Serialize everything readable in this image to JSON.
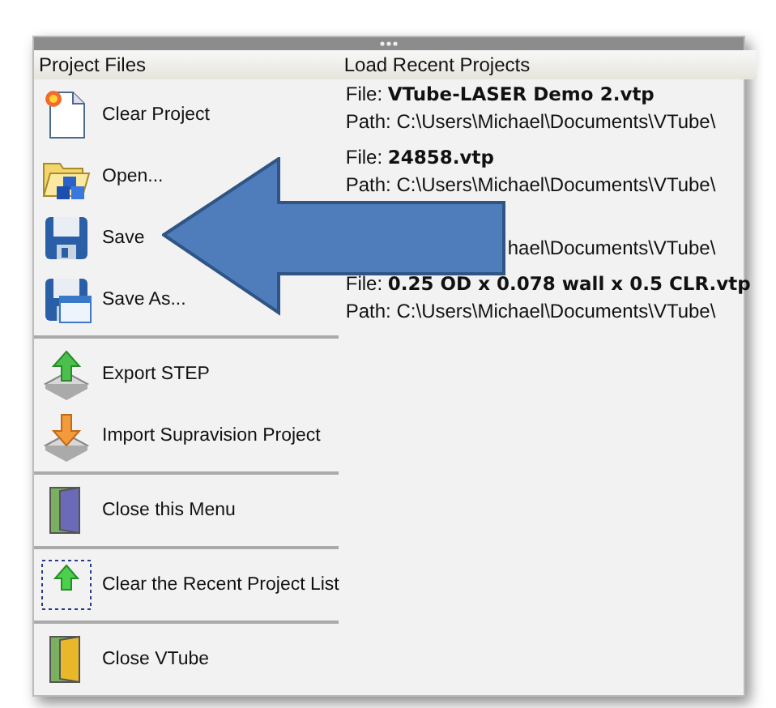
{
  "left_panel": {
    "title": "Project Files",
    "groups": [
      {
        "items": [
          {
            "kind": "clear",
            "label": "Clear Project",
            "focused": false
          },
          {
            "kind": "open",
            "label": "Open...",
            "focused": false
          },
          {
            "kind": "save",
            "label": "Save",
            "focused": false
          },
          {
            "kind": "save_as",
            "label": "Save As...",
            "focused": false
          }
        ]
      },
      {
        "items": [
          {
            "kind": "export",
            "label": "Export STEP",
            "focused": false
          },
          {
            "kind": "import",
            "label": "Import Supravision Project",
            "focused": false
          }
        ]
      },
      {
        "items": [
          {
            "kind": "close_menu",
            "label": "Close this Menu",
            "focused": false
          }
        ]
      },
      {
        "items": [
          {
            "kind": "clear_list",
            "label": "Clear the Recent Project List",
            "focused": true
          }
        ]
      },
      {
        "items": [
          {
            "kind": "exit",
            "label": "Close VTube",
            "focused": false
          }
        ]
      }
    ]
  },
  "right_panel": {
    "title": "Load Recent Projects",
    "projects": [
      {
        "file_label": "File:",
        "file": "VTube-LASER Demo 2.vtp",
        "path": "Path:  C:\\Users\\Michael\\Documents\\VTube\\"
      },
      {
        "file_label": "File:",
        "file": "24858.vtp",
        "path": "Path:  C:\\Users\\Michael\\Documents\\VTube\\"
      },
      {
        "path": "hael\\Documents\\VTube\\"
      },
      {
        "file_label": "File:",
        "file": "0.25 OD x 0.078 wall x 0.5 CLR.vtp",
        "path": "Path:  C:\\Users\\Michael\\Documents\\VTube\\"
      }
    ]
  }
}
